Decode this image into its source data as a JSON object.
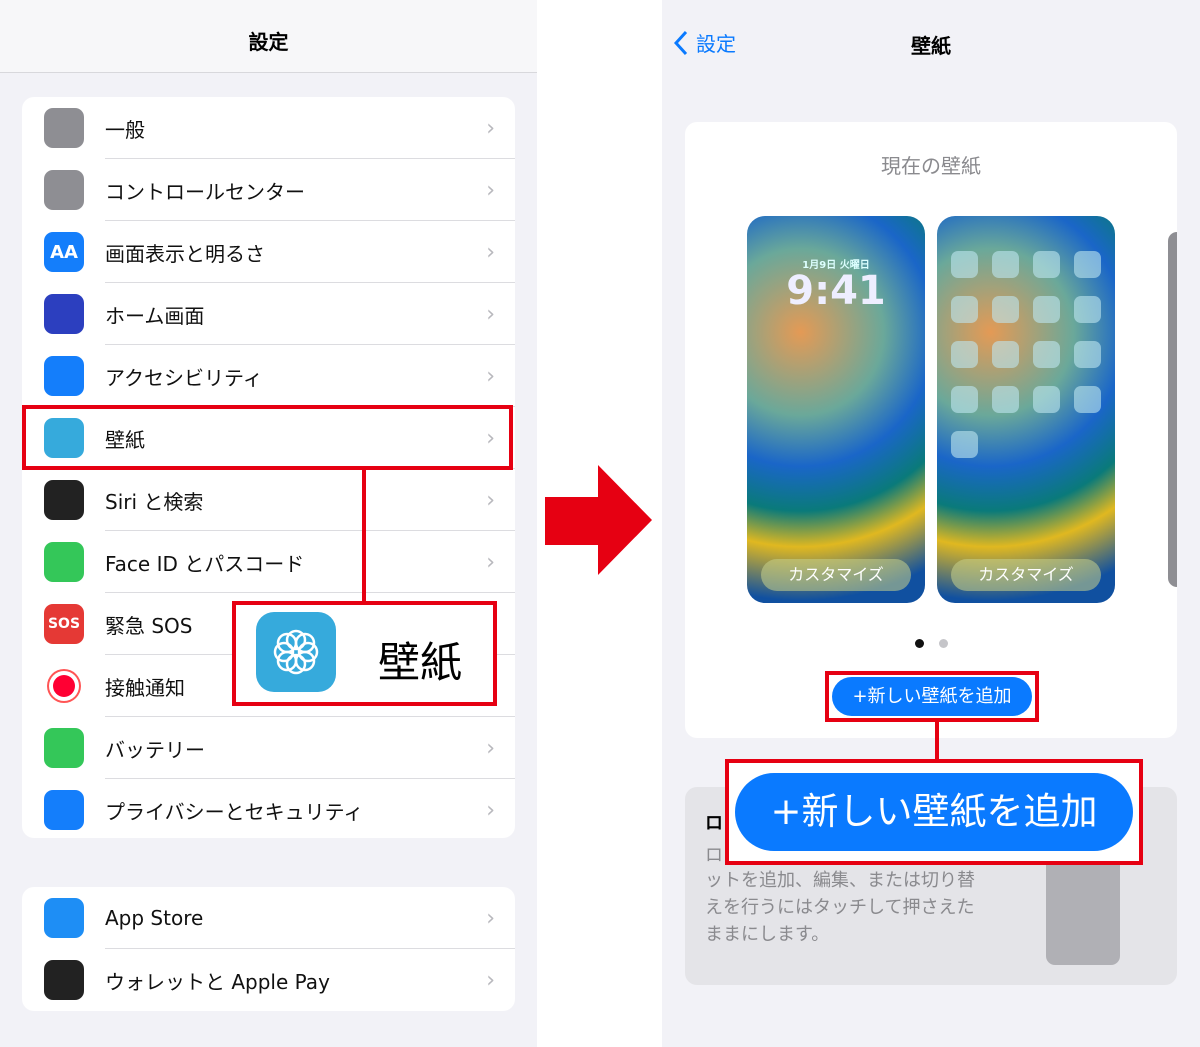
{
  "left": {
    "title": "設定",
    "group1": [
      {
        "label": "一般",
        "icon": "gear-icon",
        "color": "#8e8e93"
      },
      {
        "label": "コントロールセンター",
        "icon": "toggle-icon",
        "color": "#8e8e93"
      },
      {
        "label": "画面表示と明るさ",
        "icon": "text-size-icon",
        "color": "#147efb",
        "glyph": "AA"
      },
      {
        "label": "ホーム画面",
        "icon": "home-grid-icon",
        "color": "#2c3fbf"
      },
      {
        "label": "アクセシビリティ",
        "icon": "accessibility-icon",
        "color": "#147efb"
      },
      {
        "label": "壁紙",
        "icon": "wallpaper-flower-icon",
        "color": "#36aadc"
      },
      {
        "label": "Siri と検索",
        "icon": "siri-icon",
        "color": "#222"
      },
      {
        "label": "Face ID とパスコード",
        "icon": "face-id-icon",
        "color": "#34c759"
      },
      {
        "label": "緊急 SOS",
        "icon": "sos-icon",
        "color": "#e53935",
        "glyph": "SOS"
      },
      {
        "label": "接触通知",
        "icon": "exposure-icon",
        "color": "#fff"
      },
      {
        "label": "バッテリー",
        "icon": "battery-icon",
        "color": "#34c759"
      },
      {
        "label": "プライバシーとセキュリティ",
        "icon": "hand-icon",
        "color": "#147efb"
      }
    ],
    "group2": [
      {
        "label": "App Store",
        "icon": "app-store-icon",
        "color": "#1e8ef5"
      },
      {
        "label": "ウォレットと Apple Pay",
        "icon": "wallet-icon",
        "color": "#222"
      }
    ],
    "callout_label": "壁紙"
  },
  "right": {
    "back_label": "設定",
    "title": "壁紙",
    "current_label": "現在の壁紙",
    "lock_date": "1月9日 火曜日",
    "lock_time": "9:41",
    "customize": "カスタマイズ",
    "add_button": "+新しい壁紙を追加",
    "add_button_zoom": "+新しい壁紙を追加",
    "lower_title": "ロ",
    "lower_line0": "ロ",
    "lower_lines": [
      "ットを追加、編集、または切り替",
      "えを行うにはタッチして押さえた",
      "ままにします。"
    ],
    "page_dots": {
      "count": 2,
      "active": 1
    }
  },
  "colors": {
    "highlight": "#e60012",
    "accent": "#0a7aff"
  }
}
